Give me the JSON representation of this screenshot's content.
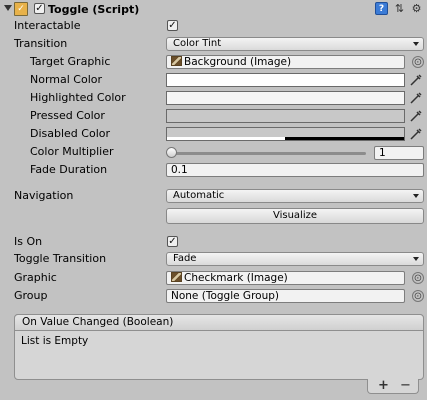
{
  "header": {
    "title": "Toggle (Script)",
    "enabled": true,
    "icons": [
      "foldout-arrow-icon",
      "script-icon",
      "help-icon",
      "settings-icon",
      "gear-icon"
    ]
  },
  "props": {
    "interactable": "Interactable",
    "transition": "Transition",
    "transition_value": "Color Tint",
    "target_graphic": "Target Graphic",
    "target_graphic_value": "Background (Image)",
    "normal_color": "Normal Color",
    "highlighted_color": "Highlighted Color",
    "pressed_color": "Pressed Color",
    "disabled_color": "Disabled Color",
    "color_multiplier": "Color Multiplier",
    "color_multiplier_value": "1",
    "fade_duration": "Fade Duration",
    "fade_duration_value": "0.1",
    "navigation": "Navigation",
    "navigation_value": "Automatic",
    "visualize": "Visualize",
    "is_on": "Is On",
    "toggle_transition": "Toggle Transition",
    "toggle_transition_value": "Fade",
    "graphic": "Graphic",
    "graphic_value": "Checkmark (Image)",
    "group": "Group",
    "group_value": "None (Toggle Group)"
  },
  "colors": {
    "normal": "#ffffff",
    "highlighted": "#f5f5f5",
    "pressed": "#c8c8c8",
    "disabled": "#c8c8c8"
  },
  "event": {
    "title": "On Value Changed (Boolean)",
    "empty": "List is Empty",
    "add": "+",
    "remove": "−"
  },
  "checks": {
    "check_mark": "✓"
  }
}
